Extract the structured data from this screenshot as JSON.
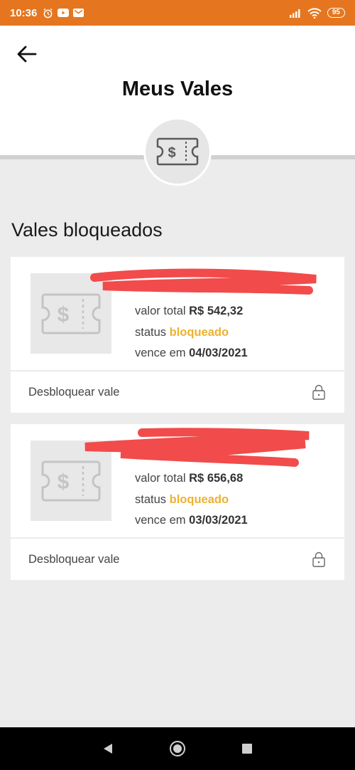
{
  "status_bar": {
    "time": "10:36",
    "battery": "95"
  },
  "header": {
    "title": "Meus Vales"
  },
  "section": {
    "title": "Vales bloqueados"
  },
  "vouchers": [
    {
      "total_label": "valor total",
      "total_value": "R$ 542,32",
      "status_label": "status",
      "status_value": "bloqueado",
      "due_label": "vence em",
      "due_value": "04/03/2021",
      "action_label": "Desbloquear vale"
    },
    {
      "total_label": "valor total",
      "total_value": "R$ 656,68",
      "status_label": "status",
      "status_value": "bloqueado",
      "due_label": "vence em",
      "due_value": "03/03/2021",
      "action_label": "Desbloquear vale"
    }
  ],
  "colors": {
    "accent": "#e5761f",
    "status": "#efb12e",
    "redaction": "#f24b4b"
  },
  "icons": [
    "back-arrow-icon",
    "voucher-icon",
    "lock-icon",
    "nav-back-icon",
    "nav-home-icon",
    "nav-recents-icon"
  ]
}
